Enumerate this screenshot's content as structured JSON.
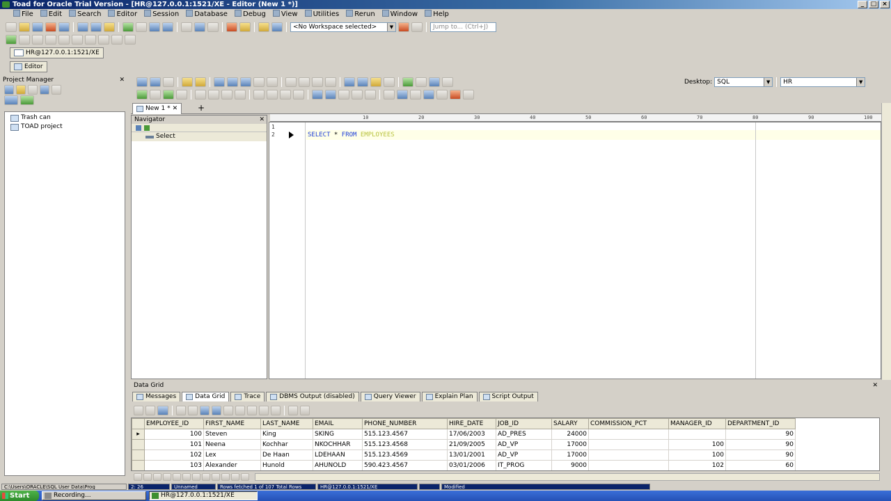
{
  "window": {
    "title": "Toad for Oracle Trial Version - [HR@127.0.0.1:1521/XE - Editor (New 1 *)]"
  },
  "menu": [
    "File",
    "Edit",
    "Search",
    "Editor",
    "Session",
    "Database",
    "Debug",
    "View",
    "Utilities",
    "Rerun",
    "Window",
    "Help"
  ],
  "toolbar": {
    "workspace": "<No Workspace selected>",
    "jump_placeholder": "Jump to... (Ctrl+J)",
    "desktop_label": "Desktop:",
    "desktop_value": "SQL",
    "schema_value": "HR"
  },
  "connection": {
    "label": "HR@127.0.0.1:1521/XE"
  },
  "editor_tab_button": "Editor",
  "project_manager": {
    "title": "Project Manager",
    "items": [
      "Trash can",
      "TOAD project"
    ]
  },
  "navigator": {
    "title": "Navigator",
    "items": [
      "Select"
    ]
  },
  "editor": {
    "tab": "New 1 *",
    "line_numbers": [
      "1",
      "2"
    ],
    "ruler_ticks": [
      "10",
      "20",
      "30",
      "40",
      "50",
      "60",
      "70",
      "80",
      "90",
      "100"
    ],
    "sql": {
      "kw1": "SELECT",
      "op": " * ",
      "kw2": "FROM",
      "table": " EMPLOYEES"
    }
  },
  "data_grid": {
    "title": "Data Grid",
    "tabs": [
      "Messages",
      "Data Grid",
      "Trace",
      "DBMS Output (disabled)",
      "Query Viewer",
      "Explain Plan",
      "Script Output"
    ],
    "columns": [
      "EMPLOYEE_ID",
      "FIRST_NAME",
      "LAST_NAME",
      "EMAIL",
      "PHONE_NUMBER",
      "HIRE_DATE",
      "JOB_ID",
      "SALARY",
      "COMMISSION_PCT",
      "MANAGER_ID",
      "DEPARTMENT_ID"
    ],
    "rows": [
      [
        "100",
        "Steven",
        "King",
        "SKING",
        "515.123.4567",
        "17/06/2003",
        "AD_PRES",
        "24000",
        "",
        "",
        "90"
      ],
      [
        "101",
        "Neena",
        "Kochhar",
        "NKOCHHAR",
        "515.123.4568",
        "21/09/2005",
        "AD_VP",
        "17000",
        "",
        "100",
        "90"
      ],
      [
        "102",
        "Lex",
        "De Haan",
        "LDEHAAN",
        "515.123.4569",
        "13/01/2001",
        "AD_VP",
        "17000",
        "",
        "100",
        "90"
      ],
      [
        "103",
        "Alexander",
        "Hunold",
        "AHUNOLD",
        "590.423.4567",
        "03/01/2006",
        "IT_PROG",
        "9000",
        "",
        "102",
        "60"
      ]
    ]
  },
  "statusbar": [
    "C:\\Users\\ORACLE\\SQL User Data\\Prog",
    "2: 26",
    "Unnamed",
    "Rows fetched 1 of 107 Total Rows",
    "HR@127.0.0.1:1521/XE",
    "",
    "Modified"
  ],
  "taskbar": {
    "start": "Start",
    "buttons": [
      "Recording...",
      "HR@127.0.0.1:1521/XE"
    ]
  },
  "colors": {
    "title_bar": "#0a246a",
    "sql_keyword": "#1f3fd8",
    "sql_identifier": "#b8c23c",
    "grid_header": "#ece9d8"
  }
}
